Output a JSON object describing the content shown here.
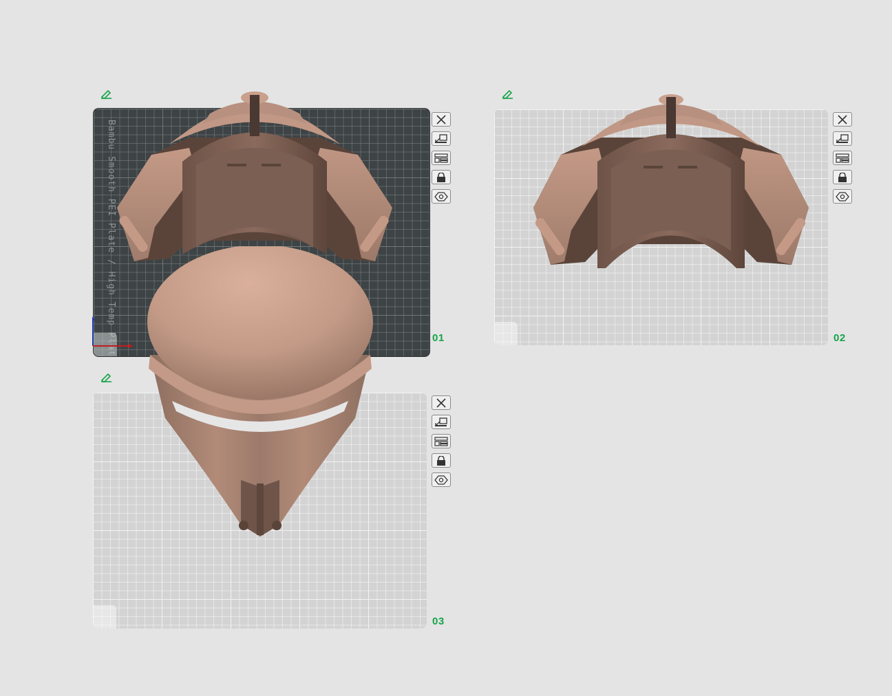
{
  "plates": [
    {
      "id": "plate-1",
      "number": "01",
      "bed_label": "Bambu Smooth PEI Plate / High Temp Plate",
      "bed_style": "dark"
    },
    {
      "id": "plate-2",
      "number": "02",
      "bed_style": "light"
    },
    {
      "id": "plate-3",
      "number": "03",
      "bed_style": "light"
    }
  ],
  "plate_tools": [
    "close-icon",
    "arrange-icon",
    "plate-settings-icon",
    "lock-icon",
    "preview-icon"
  ],
  "edit_icon": "edit-pencil-icon",
  "colors": {
    "background": "#e4e4e4",
    "accent": "#16a34a",
    "model": "#b98e7c",
    "plate_light": "#d3d3d3",
    "plate_dark": "#3e4345"
  }
}
